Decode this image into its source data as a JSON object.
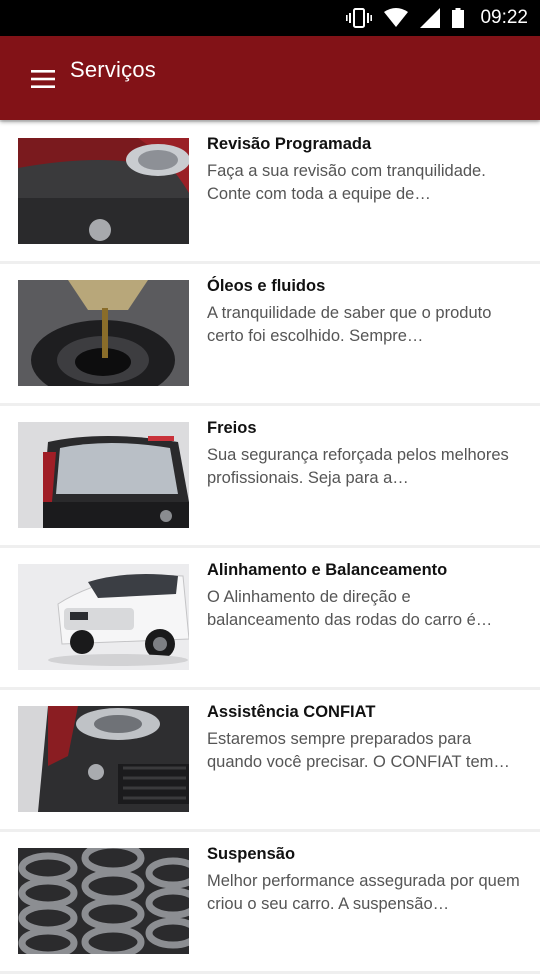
{
  "status_bar": {
    "time": "09:22",
    "icons": [
      "vibrate-icon",
      "wifi-icon",
      "cell-signal-icon",
      "battery-icon"
    ]
  },
  "app_bar": {
    "title": "Serviços",
    "menu_icon": "hamburger-menu-icon",
    "background_color": "#821217"
  },
  "services": [
    {
      "title": "Revisão Programada",
      "description": "Faça a sua revisão com tranquilidade. Conte com toda a equipe de…",
      "image": "red-car-headlight-photo"
    },
    {
      "title": "Óleos e fluidos",
      "description": "A tranquilidade de saber que o produto certo foi escolhido. Sempre…",
      "image": "oil-pouring-photo"
    },
    {
      "title": "Freios",
      "description": "Sua segurança reforçada pelos melhores profissionais. Seja para a…",
      "image": "car-rear-window-photo"
    },
    {
      "title": "Alinhamento e Balanceamento",
      "description": "O Alinhamento de direção e balanceamento das rodas do carro é…",
      "image": "white-car-front-photo"
    },
    {
      "title": "Assistência CONFIAT",
      "description": "Estaremos sempre preparados para quando você precisar. O CONFIAT tem…",
      "image": "car-bumper-closeup-photo"
    },
    {
      "title": "Suspensão",
      "description": "Melhor performance assegurada por quem criou o seu carro. A suspensão…",
      "image": "suspension-springs-photo"
    }
  ]
}
